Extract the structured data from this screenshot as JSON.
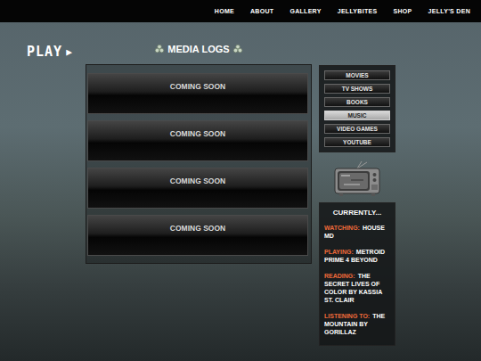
{
  "nav": {
    "items": [
      "HOME",
      "ABOUT",
      "GALLERY",
      "JELLYBITES",
      "SHOP",
      "JELLY'S DEN"
    ]
  },
  "play": {
    "label": "PLAY",
    "icon": "▶"
  },
  "title": "MEDIA LOGS",
  "logs": [
    {
      "label": "COMING SOON"
    },
    {
      "label": "COMING SOON"
    },
    {
      "label": "COMING SOON"
    },
    {
      "label": "COMING SOON"
    }
  ],
  "categories": [
    {
      "label": "MOVIES",
      "selected": false
    },
    {
      "label": "TV SHOWS",
      "selected": false
    },
    {
      "label": "BOOKS",
      "selected": false
    },
    {
      "label": "MUSIC",
      "selected": true
    },
    {
      "label": "VIDEO GAMES",
      "selected": false
    },
    {
      "label": "YOUTUBE",
      "selected": false
    }
  ],
  "currently": {
    "title": "CURRENTLY...",
    "items": [
      {
        "label": "WATCHING:",
        "value": "HOUSE MD"
      },
      {
        "label": "PLAYING:",
        "value": "METROID PRIME 4 BEYOND"
      },
      {
        "label": "READING:",
        "value": "THE SECRET LIVES OF COLOR BY KASSIA ST. CLAIR"
      },
      {
        "label": "LISTENING TO:",
        "value": "THE MOUNTAIN BY GORILLAZ"
      }
    ]
  }
}
